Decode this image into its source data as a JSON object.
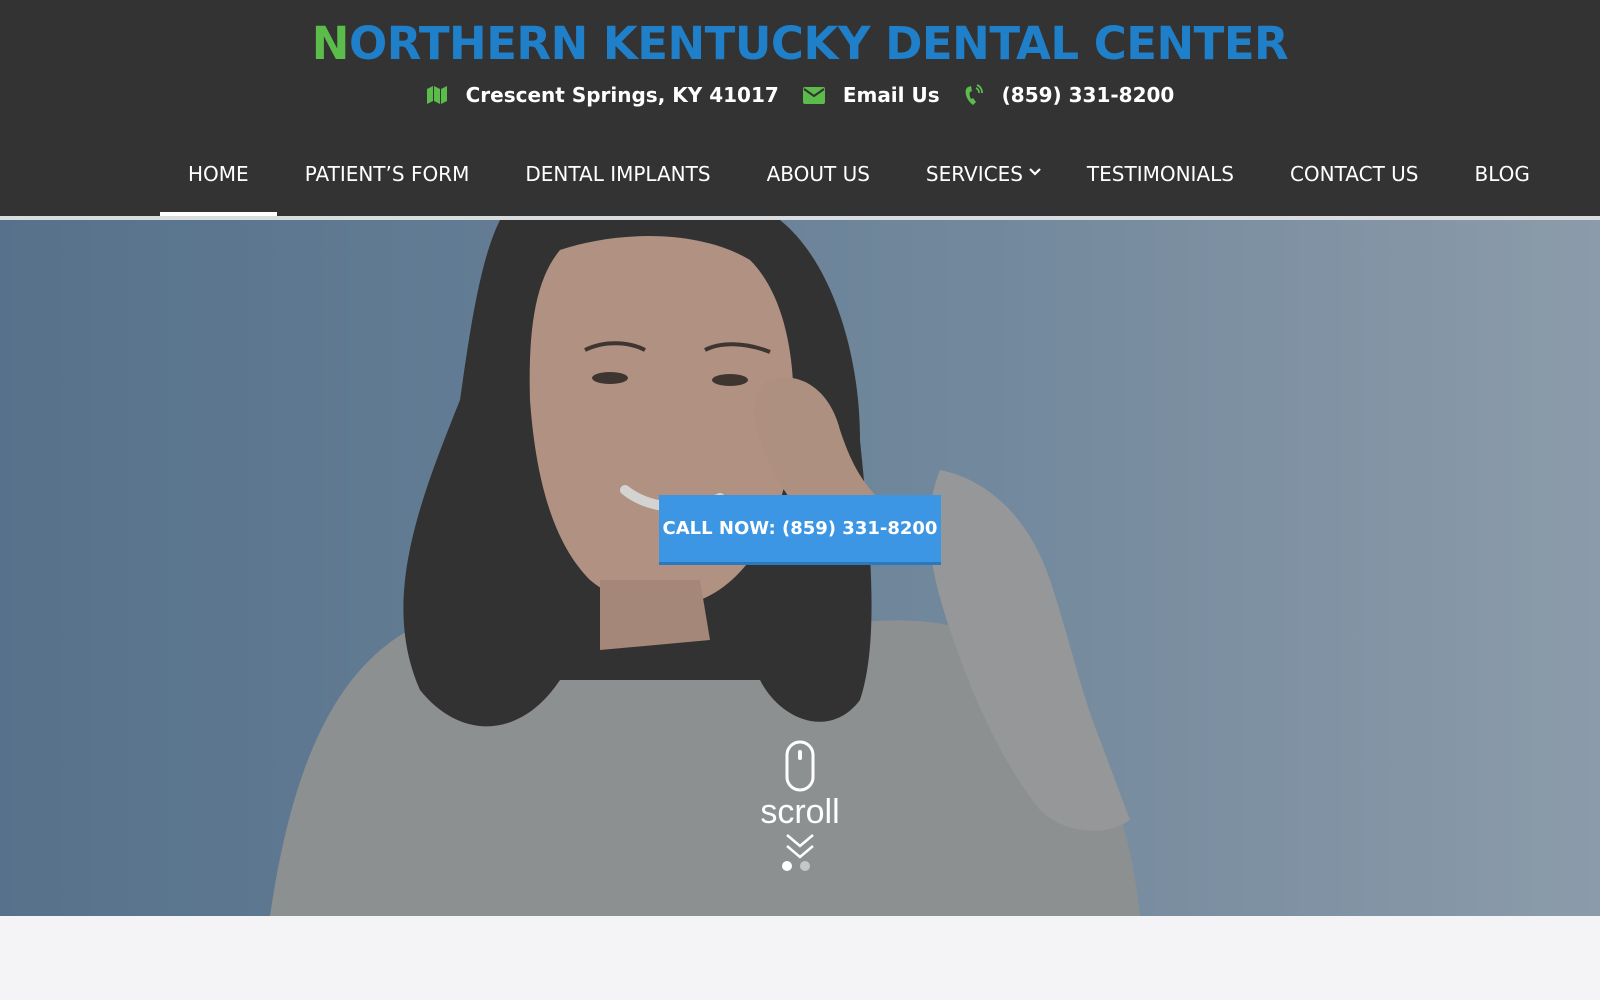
{
  "brand": {
    "first_letter": "N",
    "rest": "ORTHERN KENTUCKY DENTAL CENTER"
  },
  "contact": {
    "location": {
      "icon": "map-icon",
      "text": "Crescent Springs, KY 41017"
    },
    "email": {
      "icon": "envelope-icon",
      "text": "Email Us"
    },
    "phone": {
      "icon": "phone-icon",
      "text": "(859) 331-8200"
    }
  },
  "nav": {
    "items": [
      {
        "label": "HOME",
        "active": true
      },
      {
        "label": "PATIENT’S FORM"
      },
      {
        "label": "DENTAL IMPLANTS"
      },
      {
        "label": "ABOUT US"
      },
      {
        "label": "SERVICES",
        "dropdown": true
      },
      {
        "label": "TESTIMONIALS"
      },
      {
        "label": "CONTACT US"
      },
      {
        "label": "BLOG"
      }
    ]
  },
  "hero": {
    "cta_label": "CALL NOW: (859) 331-8200",
    "scroll_label": "scroll",
    "slides_total": 2,
    "active_slide": 1
  },
  "colors": {
    "header_bg": "#333333",
    "brand_blue": "#1f7fc9",
    "brand_green": "#5bbb4b",
    "cta_blue": "#3d96e3"
  }
}
